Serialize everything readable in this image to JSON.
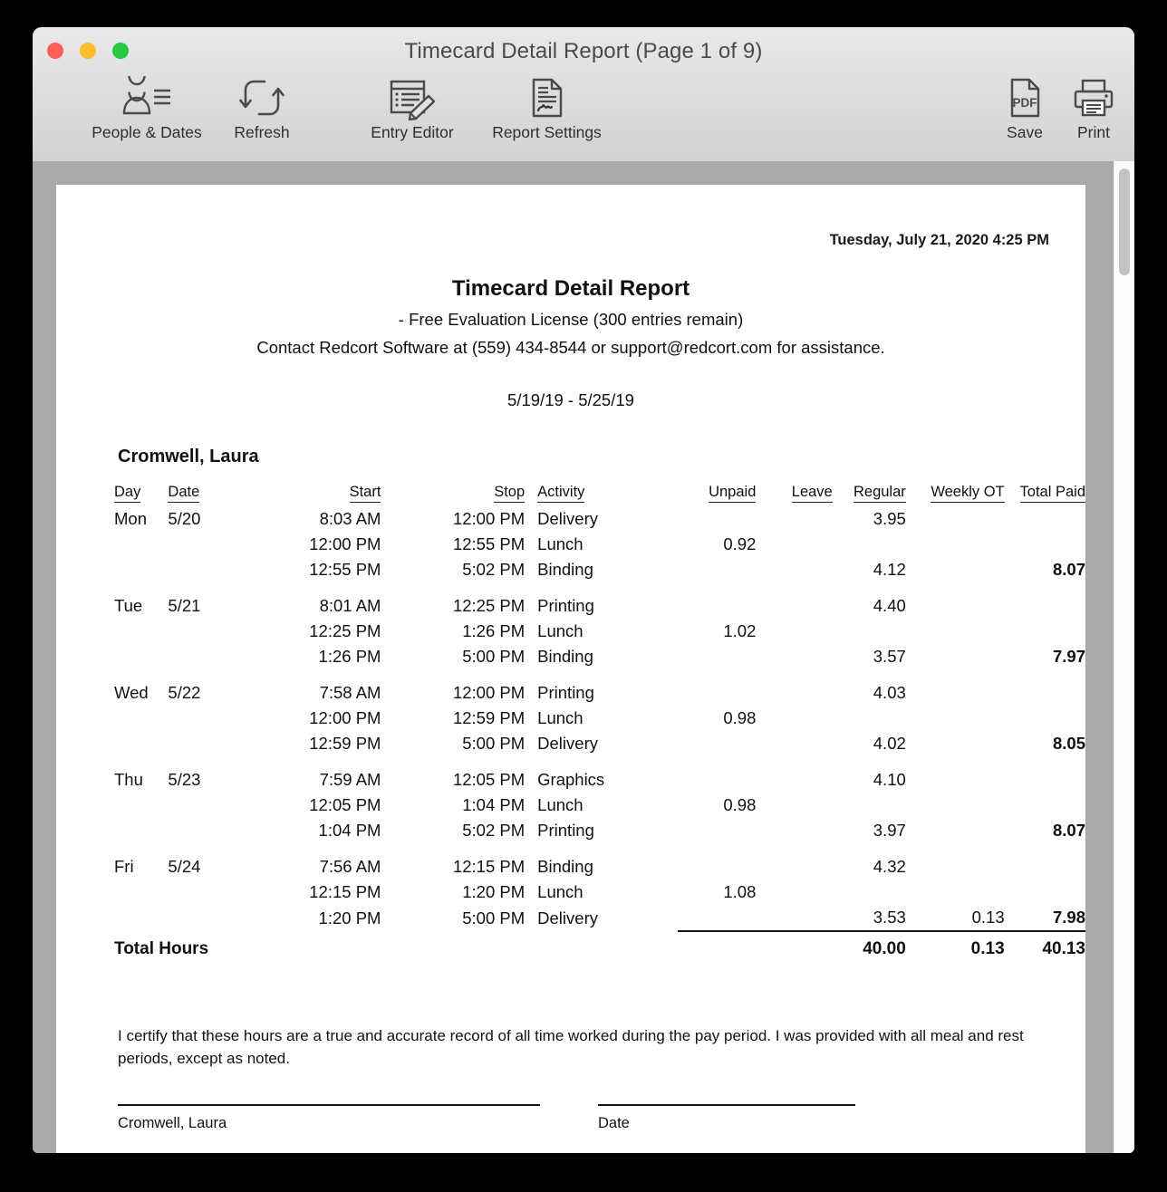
{
  "window": {
    "title": "Timecard Detail Report  (Page 1 of 9)",
    "traffic_lights": [
      "close",
      "minimize",
      "zoom"
    ]
  },
  "toolbar": {
    "items": [
      {
        "icon": "people-dates-icon",
        "label": "People & Dates"
      },
      {
        "icon": "refresh-icon",
        "label": "Refresh"
      },
      {
        "icon": "entry-editor-icon",
        "label": "Entry Editor"
      },
      {
        "icon": "report-settings-icon",
        "label": "Report Settings"
      },
      {
        "icon": "pdf-icon",
        "label": "Save"
      },
      {
        "icon": "printer-icon",
        "label": "Print"
      }
    ]
  },
  "report": {
    "printed_timestamp": "Tuesday, July 21, 2020  4:25 PM",
    "title": "Timecard Detail Report",
    "license_line": "- Free Evaluation License (300 entries remain)",
    "contact_line": "Contact Redcort Software at (559) 434-8544 or support@redcort.com for assistance.",
    "date_range": "5/19/19 - 5/25/19",
    "employee_name": "Cromwell, Laura",
    "columns": [
      "Day",
      "Date",
      "Start",
      "Stop",
      "Activity",
      "Unpaid",
      "Leave",
      "Regular",
      "Weekly OT",
      "Total Paid"
    ],
    "rows": [
      {
        "day": "Mon",
        "date": "5/20",
        "start": "8:03 AM",
        "stop": "12:00 PM",
        "activity": "Delivery",
        "unpaid": "",
        "leave": "",
        "regular": "3.95",
        "ot": "",
        "total": "",
        "first_of_day": true
      },
      {
        "day": "",
        "date": "",
        "start": "12:00 PM",
        "stop": "12:55 PM",
        "activity": "Lunch",
        "unpaid": "0.92",
        "leave": "",
        "regular": "",
        "ot": "",
        "total": "",
        "first_of_day": false
      },
      {
        "day": "",
        "date": "",
        "start": "12:55 PM",
        "stop": "5:02 PM",
        "activity": "Binding",
        "unpaid": "",
        "leave": "",
        "regular": "4.12",
        "ot": "",
        "total": "8.07",
        "first_of_day": false
      },
      {
        "day": "Tue",
        "date": "5/21",
        "start": "8:01 AM",
        "stop": "12:25 PM",
        "activity": "Printing",
        "unpaid": "",
        "leave": "",
        "regular": "4.40",
        "ot": "",
        "total": "",
        "first_of_day": true
      },
      {
        "day": "",
        "date": "",
        "start": "12:25 PM",
        "stop": "1:26 PM",
        "activity": "Lunch",
        "unpaid": "1.02",
        "leave": "",
        "regular": "",
        "ot": "",
        "total": "",
        "first_of_day": false
      },
      {
        "day": "",
        "date": "",
        "start": "1:26 PM",
        "stop": "5:00 PM",
        "activity": "Binding",
        "unpaid": "",
        "leave": "",
        "regular": "3.57",
        "ot": "",
        "total": "7.97",
        "first_of_day": false
      },
      {
        "day": "Wed",
        "date": "5/22",
        "start": "7:58 AM",
        "stop": "12:00 PM",
        "activity": "Printing",
        "unpaid": "",
        "leave": "",
        "regular": "4.03",
        "ot": "",
        "total": "",
        "first_of_day": true
      },
      {
        "day": "",
        "date": "",
        "start": "12:00 PM",
        "stop": "12:59 PM",
        "activity": "Lunch",
        "unpaid": "0.98",
        "leave": "",
        "regular": "",
        "ot": "",
        "total": "",
        "first_of_day": false
      },
      {
        "day": "",
        "date": "",
        "start": "12:59 PM",
        "stop": "5:00 PM",
        "activity": "Delivery",
        "unpaid": "",
        "leave": "",
        "regular": "4.02",
        "ot": "",
        "total": "8.05",
        "first_of_day": false
      },
      {
        "day": "Thu",
        "date": "5/23",
        "start": "7:59 AM",
        "stop": "12:05 PM",
        "activity": "Graphics",
        "unpaid": "",
        "leave": "",
        "regular": "4.10",
        "ot": "",
        "total": "",
        "first_of_day": true
      },
      {
        "day": "",
        "date": "",
        "start": "12:05 PM",
        "stop": "1:04 PM",
        "activity": "Lunch",
        "unpaid": "0.98",
        "leave": "",
        "regular": "",
        "ot": "",
        "total": "",
        "first_of_day": false
      },
      {
        "day": "",
        "date": "",
        "start": "1:04 PM",
        "stop": "5:02 PM",
        "activity": "Printing",
        "unpaid": "",
        "leave": "",
        "regular": "3.97",
        "ot": "",
        "total": "8.07",
        "first_of_day": false
      },
      {
        "day": "Fri",
        "date": "5/24",
        "start": "7:56 AM",
        "stop": "12:15 PM",
        "activity": "Binding",
        "unpaid": "",
        "leave": "",
        "regular": "4.32",
        "ot": "",
        "total": "",
        "first_of_day": true
      },
      {
        "day": "",
        "date": "",
        "start": "12:15 PM",
        "stop": "1:20 PM",
        "activity": "Lunch",
        "unpaid": "1.08",
        "leave": "",
        "regular": "",
        "ot": "",
        "total": "",
        "first_of_day": false
      },
      {
        "day": "",
        "date": "",
        "start": "1:20 PM",
        "stop": "5:00 PM",
        "activity": "Delivery",
        "unpaid": "",
        "leave": "",
        "regular": "3.53",
        "ot": "0.13",
        "total": "7.98",
        "first_of_day": false,
        "ruled": true
      }
    ],
    "totals": {
      "label": "Total Hours",
      "unpaid": "",
      "leave": "",
      "regular": "40.00",
      "ot": "0.13",
      "total": "40.13"
    },
    "certification": "I certify that these hours are a true and accurate record of all time worked during the pay period. I was provided with all meal and rest periods, except as noted.",
    "signature_label": "Cromwell, Laura",
    "date_label": "Date"
  },
  "colors": {
    "window_chrome": "#dcdcdc",
    "doc_background": "#a9a9a9",
    "page": "#ffffff",
    "close": "#ff5f57",
    "minimize": "#febc2e",
    "zoom": "#28c840",
    "icon_stroke": "#4a4a4a"
  }
}
